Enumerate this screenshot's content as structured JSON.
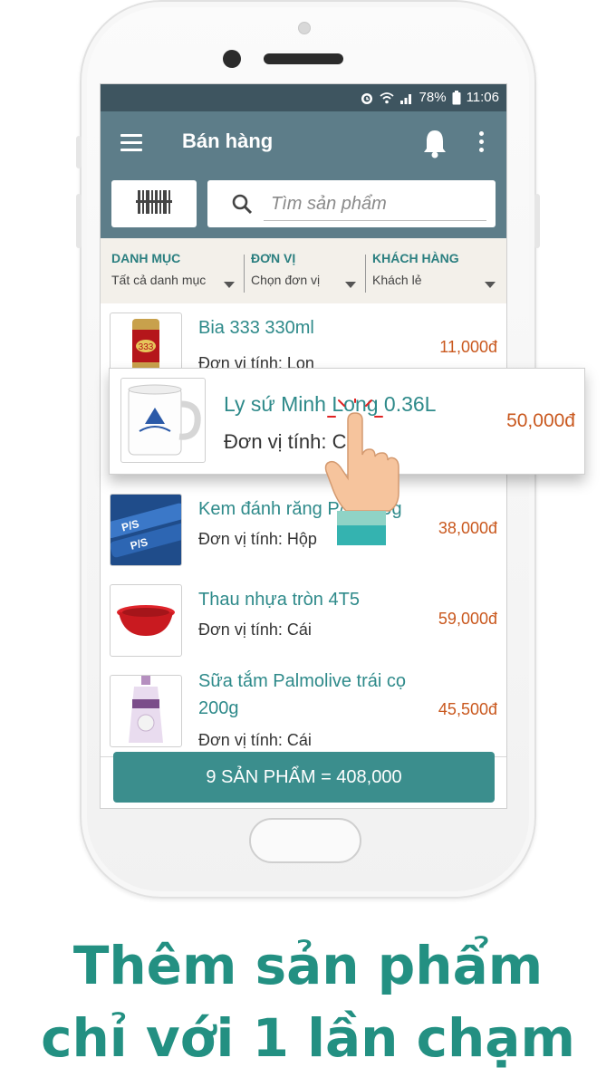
{
  "status_bar": {
    "battery": "78%",
    "time": "11:06"
  },
  "app_bar": {
    "title": "Bán hàng"
  },
  "search": {
    "placeholder": "Tìm sản phẩm"
  },
  "filters": [
    {
      "label": "DANH MỤC",
      "value": "Tất cả danh mục"
    },
    {
      "label": "ĐƠN VỊ",
      "value": "Chọn đơn vị"
    },
    {
      "label": "KHÁCH HÀNG",
      "value": "Khách lẻ"
    }
  ],
  "products": [
    {
      "name": "Bia 333 330ml",
      "unit": "Đơn vị tính: Lon",
      "price": "11,000đ",
      "image": "beer-can"
    },
    {
      "name": "Kem đánh răng P/S 230g",
      "unit": "Đơn vị tính: Hộp",
      "price": "38,000đ",
      "image": "toothpaste"
    },
    {
      "name": "Thau nhựa tròn 4T5",
      "unit": "Đơn vị tính: Cái",
      "price": "59,000đ",
      "image": "red-basin"
    },
    {
      "name": "Sữa tắm Palmolive trái cọ 200g",
      "unit": "Đơn vị tính: Cái",
      "price": "45,500đ",
      "image": "body-wash"
    }
  ],
  "popup_product": {
    "name": "Ly sứ Minh Long 0.36L",
    "unit": "Đơn vị tính: Cái",
    "price": "50,000đ",
    "image": "porcelain-mug"
  },
  "total_button": {
    "label": "9 SẢN PHẨM = 408,000"
  },
  "caption": {
    "line1": "Thêm sản phẩm",
    "line2": "chỉ với 1 lần chạm"
  },
  "colors": {
    "app_bar": "#5d7d89",
    "accent": "#2e8a8a",
    "price": "#c9581e",
    "total_button": "#3b8e8d",
    "caption": "#239082"
  },
  "icons": [
    "menu-icon",
    "bell-icon",
    "more-vert-icon",
    "barcode-scan-icon",
    "search-icon",
    "alarm-icon",
    "wifi-icon",
    "signal-icon",
    "battery-icon",
    "pointing-hand-icon"
  ]
}
